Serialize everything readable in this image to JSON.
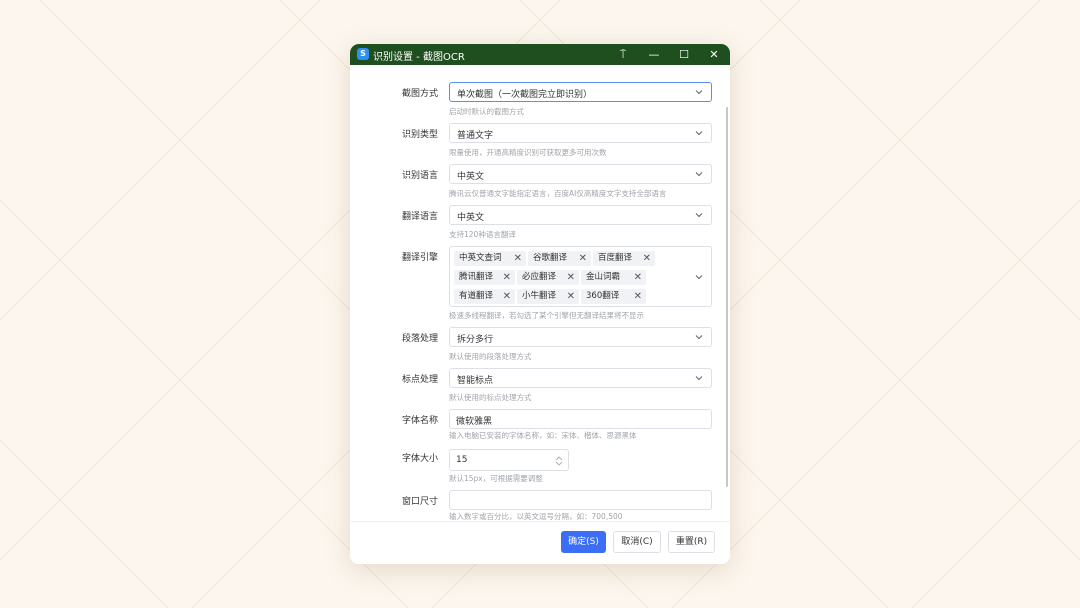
{
  "window": {
    "title": "识别设置 - 截图OCR",
    "app_icon_glyph": "S",
    "pin_glyph": "⍑",
    "minimize_glyph": "—",
    "maximize_glyph": "☐",
    "close_glyph": "✕"
  },
  "fields": {
    "capture_mode": {
      "label": "截图方式",
      "value": "单次截图（一次截图完立即识别）",
      "hint": "启动时默认的截图方式"
    },
    "recognition_type": {
      "label": "识别类型",
      "value": "普通文字",
      "hint": "限量使用，开通高精度识别可获取更多可用次数"
    },
    "recognition_language": {
      "label": "识别语言",
      "value": "中英文",
      "hint": "腾讯云仅普通文字能指定语言，百度AI仅高精度文字支持全部语言"
    },
    "translation_language": {
      "label": "翻译语言",
      "value": "中英文",
      "hint": "支持120种语言翻译"
    },
    "translation_engine": {
      "label": "翻译引擎",
      "tags": [
        "中英文查词",
        "谷歌翻译",
        "百度翻译",
        "腾讯翻译",
        "必应翻译",
        "金山词霸",
        "有道翻译",
        "小牛翻译",
        "360翻译"
      ],
      "tag_close_glyph": "✕",
      "hint": "极速多线程翻译，若勾选了某个引擎但无翻译结果将不显示"
    },
    "paragraph": {
      "label": "段落处理",
      "value": "拆分多行",
      "hint": "默认使用的段落处理方式"
    },
    "punctuation": {
      "label": "标点处理",
      "value": "智能标点",
      "hint": "默认使用的标点处理方式"
    },
    "font_name": {
      "label": "字体名称",
      "value": "微软雅黑",
      "hint": "输入电脑已安装的字体名称，如：宋体、楷体、思源黑体"
    },
    "font_size": {
      "label": "字体大小",
      "value": "15",
      "hint": "默认15px，可根据需要调整"
    },
    "window_size": {
      "label": "窗口尺寸",
      "value": "",
      "hint": "输入数字或百分比，以英文逗号分隔，如：700,500"
    }
  },
  "footer": {
    "confirm_label": "确定(S)",
    "cancel_label": "取消(C)",
    "reset_label": "重置(R)"
  },
  "colors": {
    "titlebar": "#1f4f1e",
    "primary": "#3b6ef5",
    "focus_border": "#5b8ef4",
    "background": "#fcf6ee"
  }
}
